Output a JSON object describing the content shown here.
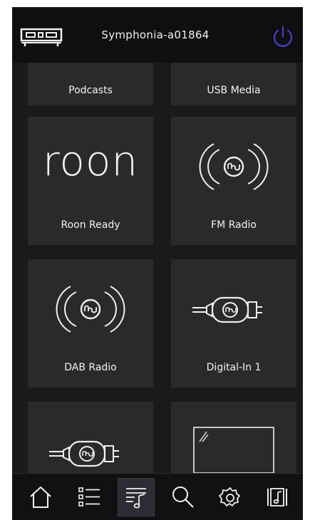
{
  "header": {
    "device_name": "Symphonia-a01864",
    "device_icon": "amplifier-icon",
    "power_icon": "power-icon",
    "power_color": "#4a3fd1"
  },
  "sources": [
    {
      "label": "Podcasts",
      "icon": "none"
    },
    {
      "label": "USB Media",
      "icon": "none"
    },
    {
      "label": "Roon Ready",
      "icon": "roon-logo",
      "logo_text": "roon"
    },
    {
      "label": "FM Radio",
      "icon": "radio-waves-icon"
    },
    {
      "label": "DAB Radio",
      "icon": "radio-waves-icon"
    },
    {
      "label": "Digital-In 1",
      "icon": "digital-cable-icon"
    },
    {
      "label": "",
      "icon": "digital-cable-icon"
    },
    {
      "label": "",
      "icon": "screen-icon"
    }
  ],
  "bottom_nav": [
    {
      "name": "home-icon",
      "active": false
    },
    {
      "name": "list-icon",
      "active": false
    },
    {
      "name": "music-queue-icon",
      "active": true
    },
    {
      "name": "search-icon",
      "active": false
    },
    {
      "name": "gear-icon",
      "active": false
    },
    {
      "name": "music-note-icon",
      "active": false
    }
  ],
  "colors": {
    "background": "#1a1a1a",
    "tile": "#2a2a2a",
    "text": "#f2f2f2",
    "accent": "#4a3fd1"
  }
}
